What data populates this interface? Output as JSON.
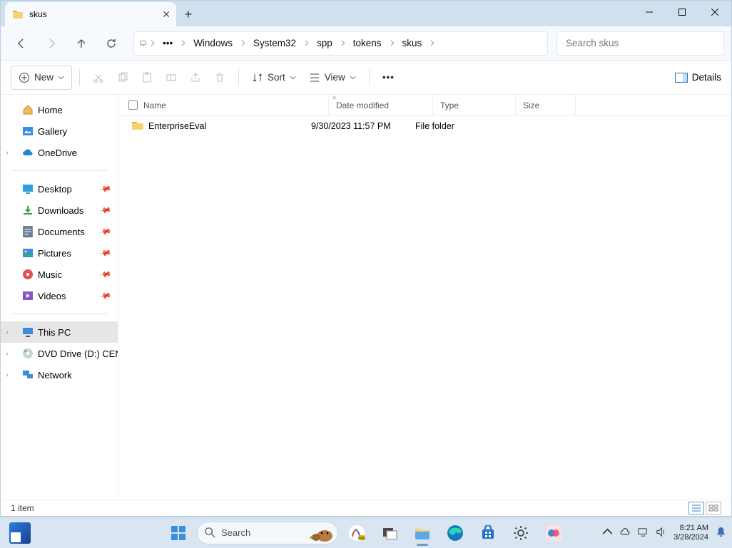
{
  "window": {
    "tab_title": "skus",
    "breadcrumbs": [
      "Windows",
      "System32",
      "spp",
      "tokens",
      "skus"
    ],
    "search_placeholder": "Search skus"
  },
  "toolbar": {
    "new_label": "New",
    "sort_label": "Sort",
    "view_label": "View",
    "details_label": "Details"
  },
  "sidebar": {
    "home": "Home",
    "gallery": "Gallery",
    "onedrive": "OneDrive",
    "desktop": "Desktop",
    "downloads": "Downloads",
    "documents": "Documents",
    "pictures": "Pictures",
    "music": "Music",
    "videos": "Videos",
    "thispc": "This PC",
    "dvd": "DVD Drive (D:) CEN",
    "network": "Network"
  },
  "columns": {
    "name": "Name",
    "date": "Date modified",
    "type": "Type",
    "size": "Size"
  },
  "rows": [
    {
      "name": "EnterpriseEval",
      "date": "9/30/2023 11:57 PM",
      "type": "File folder",
      "size": ""
    }
  ],
  "status": {
    "count": "1 item"
  },
  "taskbar": {
    "search_placeholder": "Search",
    "time": "8:21 AM",
    "date": "3/28/2024"
  }
}
